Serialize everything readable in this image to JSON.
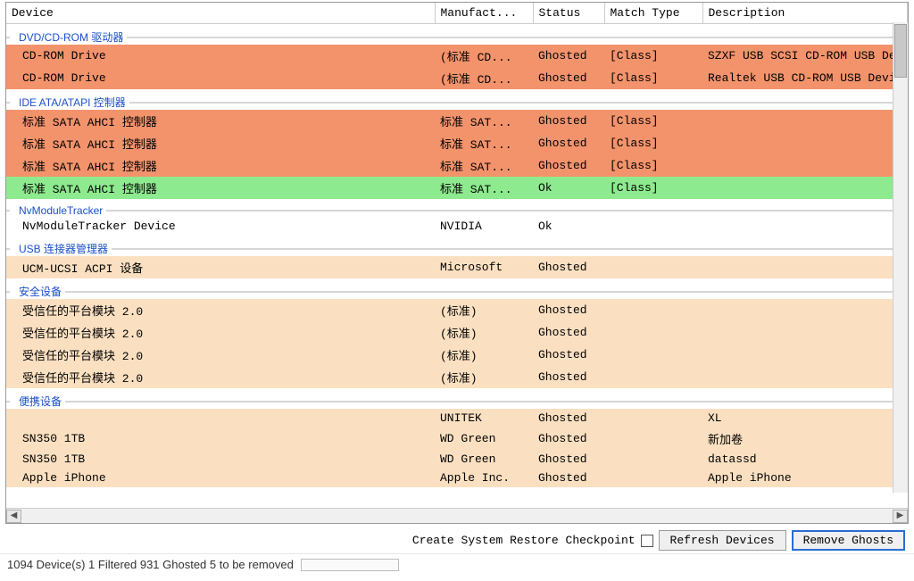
{
  "columns": {
    "device": "Device",
    "manufacturer": "Manufact...",
    "status": "Status",
    "matchType": "Match Type",
    "description": "Description"
  },
  "categories": [
    {
      "name": "DVD/CD-ROM 驱动器",
      "rows": [
        {
          "device": "CD-ROM Drive",
          "manuf": "(标准 CD...",
          "status": "Ghosted",
          "match": "[Class]",
          "desc": "SZXF USB SCSI CD-ROM USB Dev",
          "color": "coral"
        },
        {
          "device": "CD-ROM Drive",
          "manuf": "(标准 CD...",
          "status": "Ghosted",
          "match": "[Class]",
          "desc": "Realtek USB CD-ROM USB Devic",
          "color": "coral"
        }
      ]
    },
    {
      "name": "IDE ATA/ATAPI 控制器",
      "rows": [
        {
          "device": "标准 SATA AHCI 控制器",
          "manuf": "标准 SAT...",
          "status": "Ghosted",
          "match": "[Class]",
          "desc": "",
          "color": "coral"
        },
        {
          "device": "标准 SATA AHCI 控制器",
          "manuf": "标准 SAT...",
          "status": "Ghosted",
          "match": "[Class]",
          "desc": "",
          "color": "coral"
        },
        {
          "device": "标准 SATA AHCI 控制器",
          "manuf": "标准 SAT...",
          "status": "Ghosted",
          "match": "[Class]",
          "desc": "",
          "color": "coral"
        },
        {
          "device": "标准 SATA AHCI 控制器",
          "manuf": "标准 SAT...",
          "status": "Ok",
          "match": "[Class]",
          "desc": "",
          "color": "green"
        }
      ]
    },
    {
      "name": "NvModuleTracker",
      "rows": [
        {
          "device": "NvModuleTracker Device",
          "manuf": "NVIDIA",
          "status": "Ok",
          "match": "",
          "desc": "",
          "color": "plain"
        }
      ]
    },
    {
      "name": "USB 连接器管理器",
      "rows": [
        {
          "device": "UCM-UCSI ACPI 设备",
          "manuf": "Microsoft",
          "status": "Ghosted",
          "match": "",
          "desc": "",
          "color": "peach"
        }
      ]
    },
    {
      "name": "安全设备",
      "rows": [
        {
          "device": "受信任的平台模块 2.0",
          "manuf": "(标准)",
          "status": "Ghosted",
          "match": "",
          "desc": "",
          "color": "peach"
        },
        {
          "device": "受信任的平台模块 2.0",
          "manuf": "(标准)",
          "status": "Ghosted",
          "match": "",
          "desc": "",
          "color": "peach"
        },
        {
          "device": "受信任的平台模块 2.0",
          "manuf": "(标准)",
          "status": "Ghosted",
          "match": "",
          "desc": "",
          "color": "peach"
        },
        {
          "device": "受信任的平台模块 2.0",
          "manuf": "(标准)",
          "status": "Ghosted",
          "match": "",
          "desc": "",
          "color": "peach"
        }
      ]
    },
    {
      "name": "便携设备",
      "rows": [
        {
          "device": "",
          "manuf": "UNITEK",
          "status": "Ghosted",
          "match": "",
          "desc": "XL",
          "color": "peach"
        },
        {
          "device": "SN350 1TB",
          "manuf": "WD Green",
          "status": "Ghosted",
          "match": "",
          "desc": "新加卷",
          "color": "peach"
        },
        {
          "device": "SN350 1TB",
          "manuf": "WD Green",
          "status": "Ghosted",
          "match": "",
          "desc": "datassd",
          "color": "peach"
        },
        {
          "device": "Apple iPhone",
          "manuf": "Apple Inc.",
          "status": "Ghosted",
          "match": "",
          "desc": "Apple iPhone",
          "color": "peach"
        }
      ]
    }
  ],
  "controls": {
    "restoreLabel": "Create System Restore Checkpoint",
    "refresh": "Refresh Devices",
    "remove": "Remove Ghosts"
  },
  "statusBar": "1094 Device(s)  1 Filtered  931 Ghosted  5 to be removed"
}
